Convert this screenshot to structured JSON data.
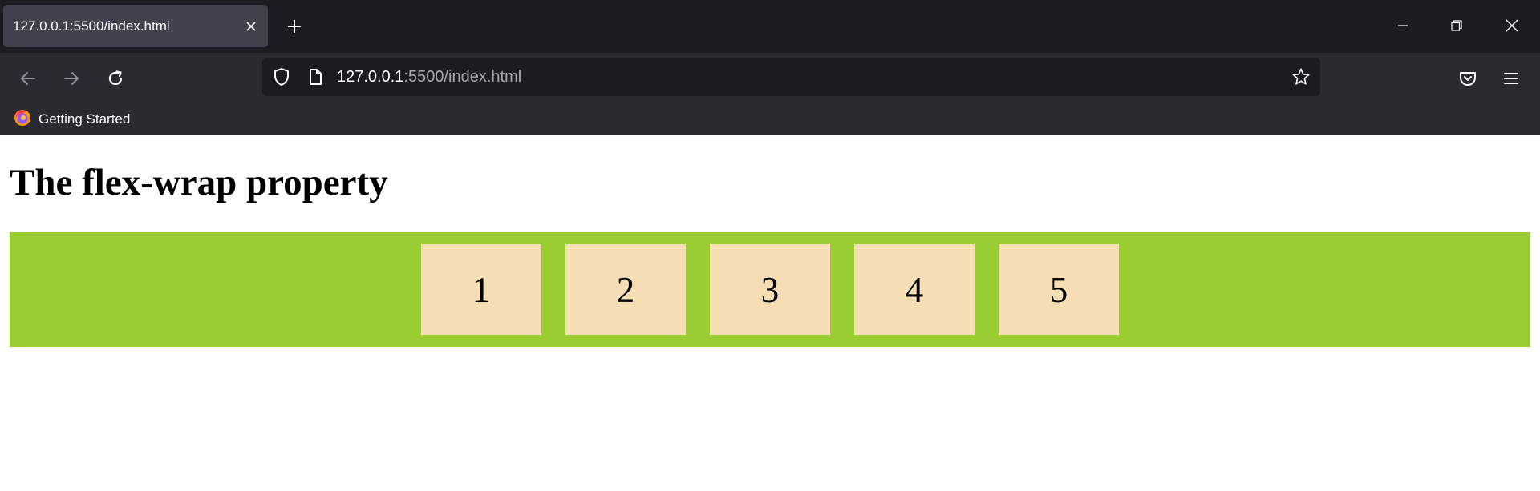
{
  "browser": {
    "tab": {
      "title": "127.0.0.1:5500/index.html"
    },
    "url": {
      "host": "127.0.0.1",
      "path": ":5500/index.html"
    },
    "bookmarks": [
      {
        "label": "Getting Started"
      }
    ]
  },
  "page": {
    "heading": "The flex-wrap property",
    "container_color": "#9acd32",
    "item_color": "#f5deb3",
    "items": [
      "1",
      "2",
      "3",
      "4",
      "5"
    ]
  }
}
